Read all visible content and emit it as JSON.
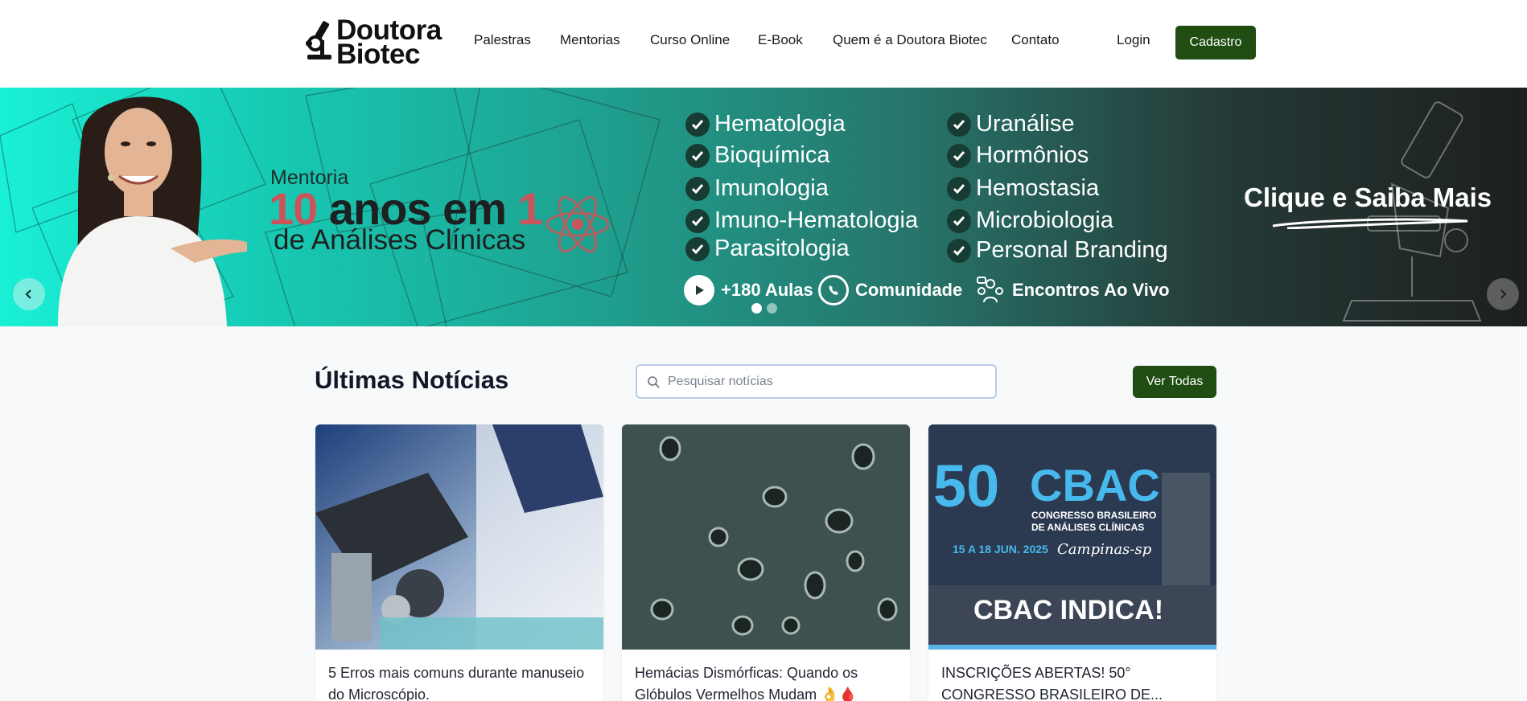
{
  "header": {
    "logo_line1": "Doutora",
    "logo_line2": "Biotec",
    "nav": [
      {
        "label": "Palestras"
      },
      {
        "label": "Mentorias"
      },
      {
        "label": "Curso Online"
      },
      {
        "label": "E-Book"
      },
      {
        "label": "Quem é a Doutora Biotec"
      },
      {
        "label": "Contato"
      }
    ],
    "login_label": "Login",
    "cadastro_label": "Cadastro"
  },
  "banner": {
    "mentoria_label": "Mentoria",
    "title_num1": "10",
    "title_mid": " anos em ",
    "title_num2": "1",
    "subtitle": "de Análises Clínicas",
    "topics_left": [
      "Hematologia",
      "Bioquímica",
      "Imunologia",
      "Imuno-Hematologia",
      "Parasitologia"
    ],
    "topics_right": [
      "Uranálise",
      "Hormônios",
      "Hemostasia",
      "Microbiologia",
      "Personal Branding"
    ],
    "features": [
      "+180 Aulas",
      "Comunidade",
      "Encontros Ao Vivo"
    ],
    "cta": "Clique e Saiba Mais",
    "active_slide": 1,
    "slide_count": 2
  },
  "news": {
    "title": "Últimas Notícias",
    "search_placeholder": "Pesquisar notícias",
    "ver_todas_label": "Ver Todas",
    "cards": [
      {
        "title": "5 Erros mais comuns durante manuseio do Microscópio."
      },
      {
        "title": "Hemácias Dismórficas: Quando os Glóbulos Vermelhos Mudam 👌🩸"
      },
      {
        "title": "INSCRIÇÕES ABERTAS! 50° CONGRESSO BRASILEIRO DE..."
      }
    ],
    "cbac": {
      "number": "50",
      "acronym": "CBAC",
      "line1": "CONGRESSO BRASILEIRO",
      "line2": "DE ANÁLISES CLÍNICAS",
      "dates": "15 A 18 JUN. 2025",
      "city": "Campinas-sp",
      "indica": "CBAC INDICA!"
    }
  },
  "colors": {
    "brand_green": "#1f4d12",
    "banner_accent": "#c9555b"
  }
}
